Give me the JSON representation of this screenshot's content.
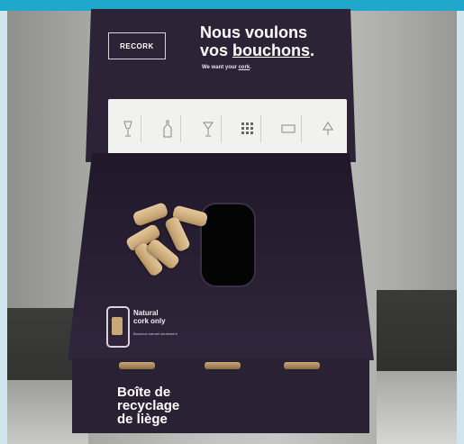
{
  "sign": {
    "logo": "RECORK",
    "headline_line1": "Nous voulons",
    "headline_line2_prefix": "vos ",
    "headline_line2_emph": "bouchons",
    "headline_line2_suffix": ".",
    "subline_prefix": "We want your ",
    "subline_emph": "cork",
    "subline_suffix": "."
  },
  "top": {
    "natural_label_1": "Natural",
    "natural_label_2": "cork only",
    "natural_sub": "Bouchon naturel seulement"
  },
  "front": {
    "title_line1": "Boîte de",
    "title_line2": "recyclage",
    "title_line3": "de liège"
  },
  "colors": {
    "frame_accent": "#1fa8cc",
    "box": "#2d2337",
    "cork": "#c9a877"
  },
  "icons": [
    "wine-glass-icon",
    "bottle-icon",
    "glass-icon",
    "grid-icon",
    "box-icon",
    "tree-icon"
  ]
}
